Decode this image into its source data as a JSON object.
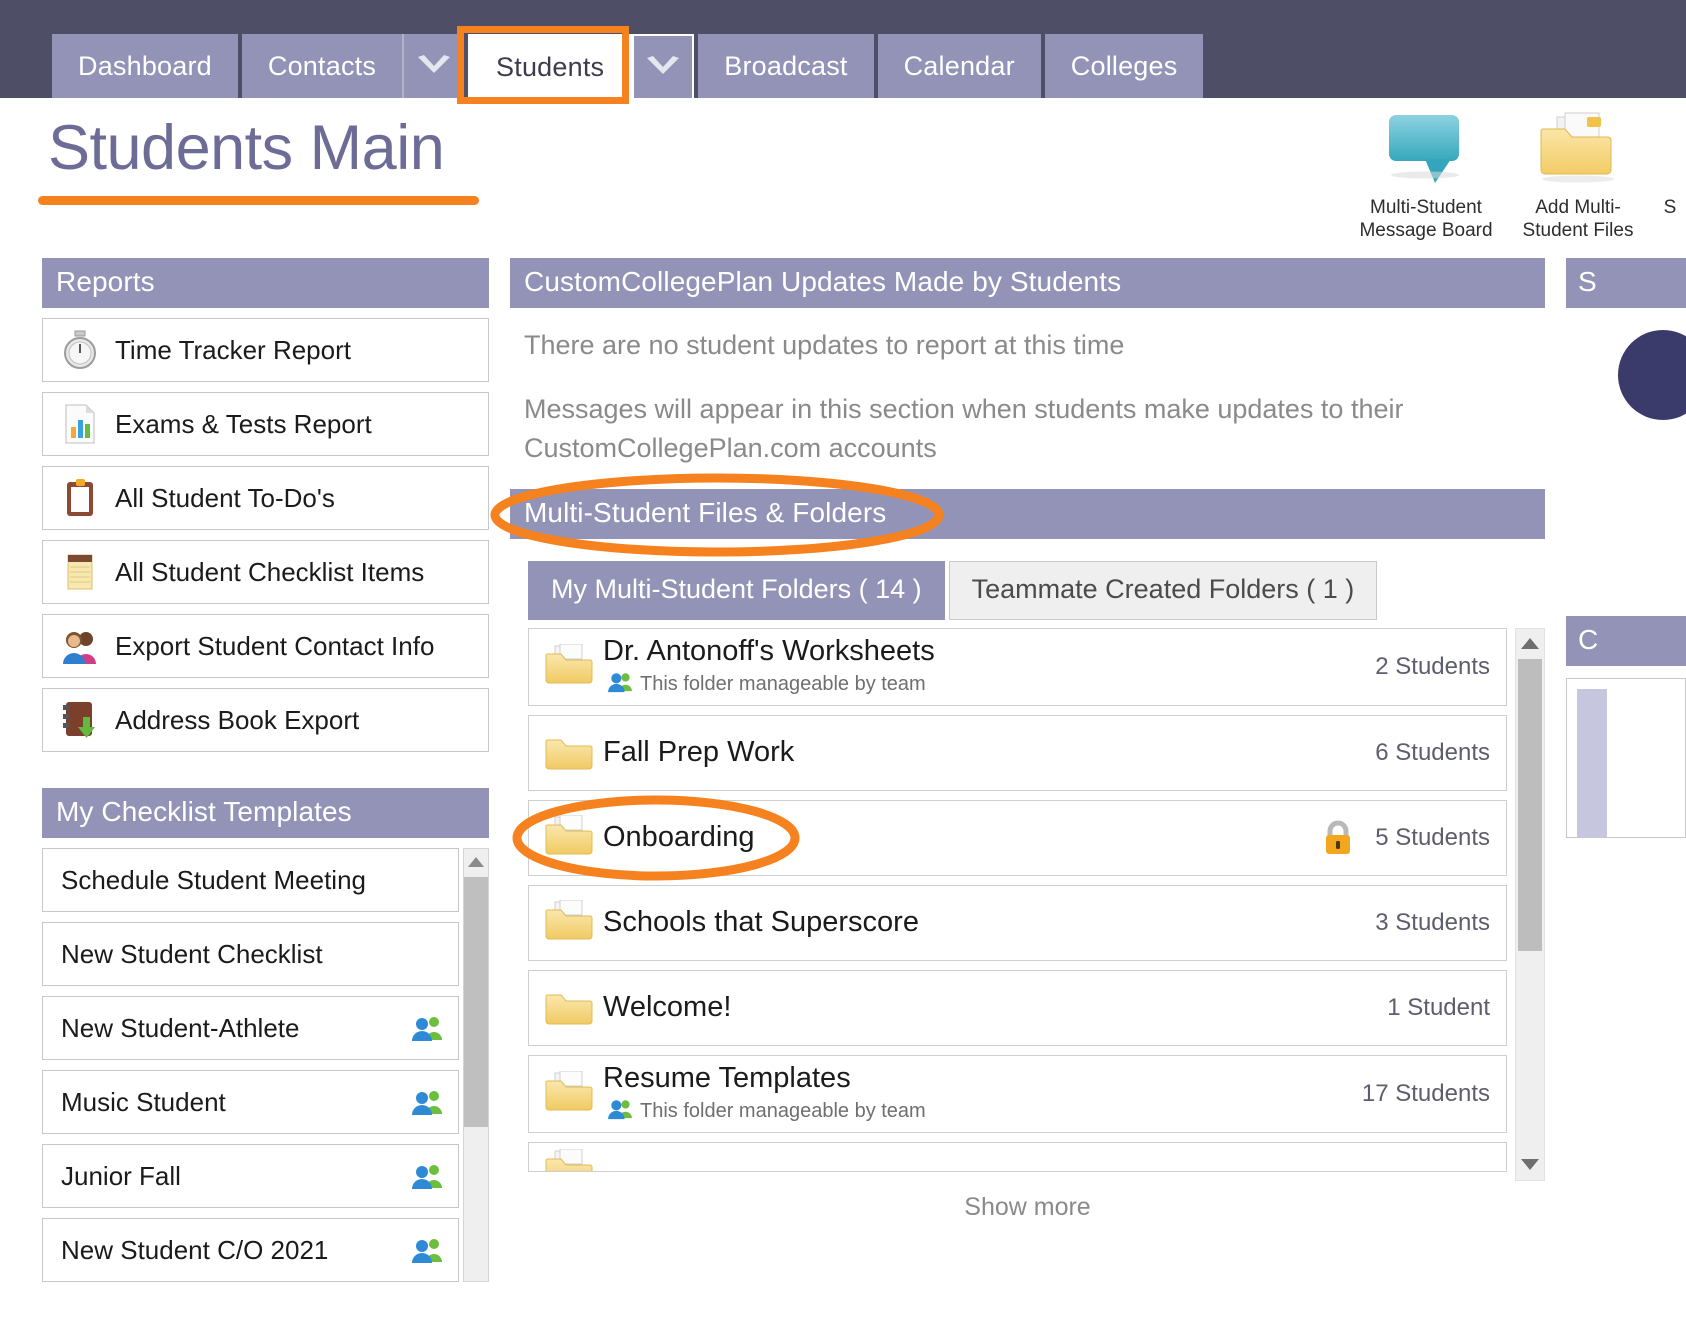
{
  "nav": {
    "tabs": [
      {
        "label": "Dashboard",
        "has_caret": false,
        "active": false
      },
      {
        "label": "Contacts",
        "has_caret": true,
        "active": false
      },
      {
        "label": "Students",
        "has_caret": true,
        "active": true,
        "highlighted": true
      },
      {
        "label": "Broadcast",
        "has_caret": false,
        "active": false
      },
      {
        "label": "Calendar",
        "has_caret": false,
        "active": false
      },
      {
        "label": "Colleges",
        "has_caret": false,
        "active": false
      }
    ],
    "caret_icon": "chevron-down-icon"
  },
  "header": {
    "title": "Students Main",
    "accent_color": "#f5821f",
    "title_color": "#6c6c96",
    "actions": [
      {
        "icon": "speech-bubble-icon",
        "line1": "Multi-Student",
        "line2": "Message Board"
      },
      {
        "icon": "add-folder-icon",
        "line1": "Add Multi-",
        "line2": "Student Files"
      },
      {
        "icon": "clipped-icon",
        "line1": "S",
        "line2": ""
      }
    ]
  },
  "sidebar": {
    "reports": {
      "title": "Reports",
      "items": [
        {
          "label": "Time Tracker Report",
          "icon": "stopwatch-icon"
        },
        {
          "label": "Exams & Tests Report",
          "icon": "bar-chart-document-icon"
        },
        {
          "label": "All Student To-Do's",
          "icon": "clipboard-icon"
        },
        {
          "label": "All Student Checklist Items",
          "icon": "notepad-icon"
        },
        {
          "label": "Export Student Contact Info",
          "icon": "two-people-icon"
        },
        {
          "label": "Address Book Export",
          "icon": "address-book-download-icon"
        }
      ]
    },
    "templates": {
      "title": "My Checklist Templates",
      "items": [
        {
          "label": "Schedule Student Meeting",
          "shared": false
        },
        {
          "label": "New Student Checklist",
          "shared": false
        },
        {
          "label": "New Student-Athlete",
          "shared": true
        },
        {
          "label": "Music Student",
          "shared": true
        },
        {
          "label": "Junior Fall",
          "shared": true
        },
        {
          "label": "New Student C/O 2021",
          "shared": true
        }
      ],
      "shared_icon": "team-people-icon",
      "scroll_up_icon": "scroll-up-arrow-icon"
    }
  },
  "main": {
    "updates_panel": {
      "title": "CustomCollegePlan Updates Made by Students",
      "empty_message": "There are no student updates to report at this time",
      "hint_message": "Messages will appear in this section when students make updates to their CustomCollegePlan.com accounts"
    },
    "files_panel": {
      "title": "Multi-Student Files & Folders",
      "highlighted": true,
      "tabs": [
        {
          "label": "My Multi-Student Folders ( 14 )",
          "active": true
        },
        {
          "label": "Teammate Created Folders ( 1 )",
          "active": false
        }
      ],
      "folders": [
        {
          "name": "Dr. Antonoff's Worksheets",
          "sub": "This folder manageable by team",
          "count": "2 Students",
          "locked": false,
          "highlighted": false
        },
        {
          "name": "Fall Prep Work",
          "sub": "",
          "count": "6 Students",
          "locked": false,
          "highlighted": false
        },
        {
          "name": "Onboarding",
          "sub": "",
          "count": "5 Students",
          "locked": true,
          "highlighted": true
        },
        {
          "name": "Schools that Superscore",
          "sub": "",
          "count": "3 Students",
          "locked": false,
          "highlighted": false
        },
        {
          "name": "Welcome!",
          "sub": "",
          "count": "1 Student",
          "locked": false,
          "highlighted": false
        },
        {
          "name": "Resume Templates",
          "sub": "This folder manageable by team",
          "count": "17 Students",
          "locked": false,
          "highlighted": false
        }
      ],
      "folder_icon": "folder-icon",
      "team_icon": "team-people-icon",
      "lock_icon": "lock-icon",
      "show_more_label": "Show more",
      "scroll_up_icon": "scroll-up-arrow-icon",
      "scroll_down_icon": "scroll-down-arrow-icon"
    }
  },
  "right_column": {
    "panel_title_clipped": "S",
    "panel_title_clipped_2": "C"
  }
}
